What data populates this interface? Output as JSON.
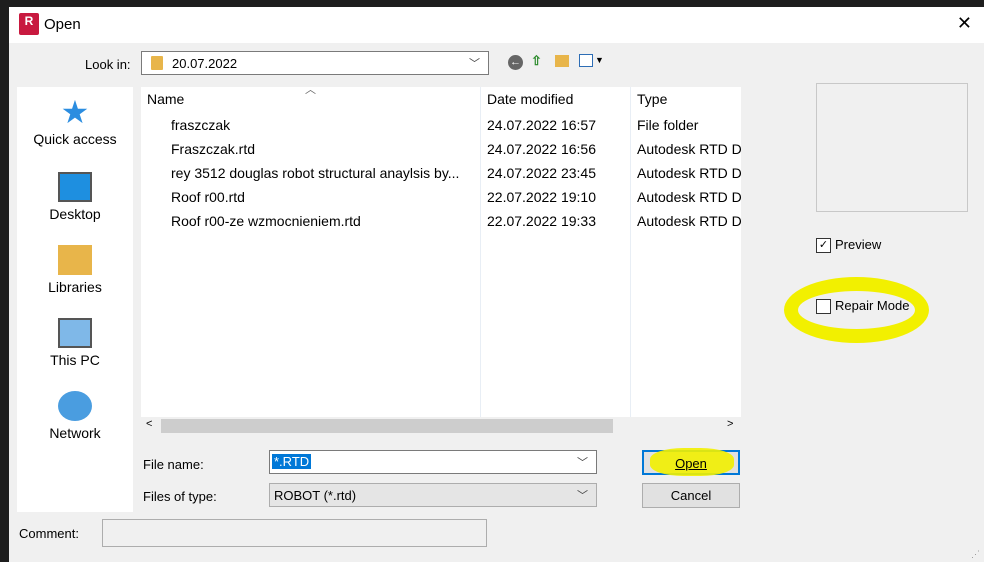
{
  "window": {
    "title": "Open",
    "close": "✕",
    "app_icon": "R"
  },
  "lookin": {
    "label": "Look in:",
    "value": "20.07.2022"
  },
  "places": [
    {
      "label": "Quick access"
    },
    {
      "label": "Desktop"
    },
    {
      "label": "Libraries"
    },
    {
      "label": "This PC"
    },
    {
      "label": "Network"
    }
  ],
  "columns": {
    "name": "Name",
    "date": "Date modified",
    "type": "Type"
  },
  "files": [
    {
      "name": "fraszczak",
      "date": "24.07.2022 16:57",
      "type": "File folder",
      "kind": "folder"
    },
    {
      "name": "Fraszczak.rtd",
      "date": "24.07.2022 16:56",
      "type": "Autodesk RTD D",
      "kind": "rtd"
    },
    {
      "name": "rey 3512 douglas robot structural anaylsis by...",
      "date": "24.07.2022 23:45",
      "type": "Autodesk RTD D",
      "kind": "rtd"
    },
    {
      "name": "Roof r00.rtd",
      "date": "22.07.2022 19:10",
      "type": "Autodesk RTD D",
      "kind": "rtd"
    },
    {
      "name": "Roof r00-ze wzmocnieniem.rtd",
      "date": "22.07.2022 19:33",
      "type": "Autodesk RTD D",
      "kind": "rtd"
    }
  ],
  "filename": {
    "label": "File name:",
    "value": "*.RTD"
  },
  "filetype": {
    "label": "Files of type:",
    "value": "ROBOT (*.rtd)"
  },
  "buttons": {
    "open": "Open",
    "cancel": "Cancel"
  },
  "preview": {
    "label": "Preview",
    "checked": true
  },
  "repair": {
    "label": "Repair Mode",
    "checked": false
  },
  "comment": {
    "label": "Comment:",
    "value": ""
  },
  "highlight_color": "#f2f000"
}
